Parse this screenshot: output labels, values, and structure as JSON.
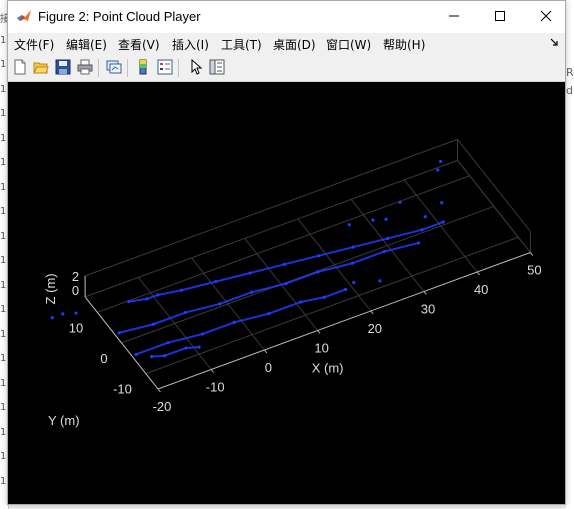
{
  "background": {
    "left_glyphs": [
      "接",
      "1",
      "1",
      "1",
      "1",
      "1",
      "1",
      "1",
      "1",
      "1",
      "1",
      "1",
      "1",
      "1",
      "1",
      "1",
      "1",
      "1",
      "1",
      "1"
    ],
    "right_glyphs": [
      "Re",
      "di"
    ]
  },
  "window": {
    "title": "Figure 2: Point Cloud Player",
    "controls": [
      "minimize",
      "maximize",
      "close"
    ]
  },
  "menu": {
    "items": [
      "文件(F)",
      "编辑(E)",
      "查看(V)",
      "插入(I)",
      "工具(T)",
      "桌面(D)",
      "窗口(W)",
      "帮助(H)"
    ]
  },
  "toolbar": {
    "buttons": [
      {
        "name": "new-figure-icon"
      },
      {
        "name": "open-file-icon"
      },
      {
        "name": "save-icon"
      },
      {
        "name": "print-icon"
      },
      {
        "name": "link-plot-icon"
      },
      {
        "name": "insert-colorbar-icon"
      },
      {
        "name": "insert-legend-icon"
      },
      {
        "name": "edit-plot-arrow-icon"
      },
      {
        "name": "property-inspector-icon"
      }
    ]
  },
  "chart_data": {
    "type": "scatter",
    "projection": "3d",
    "background_color": "#000000",
    "point_color": "#1f3cff",
    "x_label": "X (m)",
    "y_label": "Y (m)",
    "z_label": "Z (m)",
    "x_ticks": [
      -20,
      -10,
      0,
      10,
      20,
      30,
      40,
      50
    ],
    "y_ticks": [
      -10,
      0,
      10
    ],
    "z_ticks": [
      0,
      2
    ],
    "x_range": [
      -20,
      50
    ],
    "y_range": [
      -15,
      15
    ],
    "z_range": [
      -1,
      2
    ],
    "grid": true,
    "series": [
      {
        "points": [
          [
            -15,
            8,
            0
          ],
          [
            -12,
            7,
            0
          ],
          [
            -10,
            7,
            0
          ],
          [
            -6,
            6,
            0
          ],
          [
            0,
            5,
            0
          ],
          [
            6,
            4,
            0
          ],
          [
            12,
            3,
            0
          ],
          [
            18,
            2,
            0
          ],
          [
            24,
            1,
            0
          ],
          [
            30,
            0,
            0
          ],
          [
            36,
            -1,
            0
          ],
          [
            40,
            -1,
            0
          ]
        ]
      },
      {
        "points": [
          [
            -20,
            1,
            0
          ],
          [
            -14,
            0,
            0
          ],
          [
            -8,
            0,
            0
          ],
          [
            -2,
            -1,
            0
          ],
          [
            4,
            -1,
            0
          ],
          [
            10,
            -2,
            0
          ],
          [
            16,
            -2,
            0
          ],
          [
            22,
            -3,
            0
          ],
          [
            28,
            -3,
            0
          ],
          [
            34,
            -4,
            0
          ]
        ]
      },
      {
        "points": [
          [
            -20,
            -6,
            0
          ],
          [
            -14,
            -6,
            0
          ],
          [
            -8,
            -7,
            0
          ],
          [
            -2,
            -7,
            0
          ],
          [
            4,
            -8,
            0
          ],
          [
            10,
            -8,
            0
          ],
          [
            14,
            -9,
            0
          ],
          [
            18,
            -9,
            0
          ],
          [
            -18,
            -8,
            0
          ],
          [
            -16,
            -9,
            0
          ],
          [
            -12,
            -9,
            0
          ],
          [
            -10,
            -10,
            0
          ]
        ]
      },
      {
        "points": [
          [
            -28,
            11,
            0
          ],
          [
            -26,
            11,
            0
          ],
          [
            -24,
            10,
            0
          ],
          [
            44,
            10,
            1.5
          ],
          [
            45,
            11,
            2
          ],
          [
            38,
            2,
            0
          ],
          [
            32,
            5,
            0
          ],
          [
            30,
            6,
            0
          ],
          [
            36,
            8,
            0
          ],
          [
            42,
            4,
            0
          ],
          [
            26,
            7,
            0
          ],
          [
            20,
            -8,
            0
          ],
          [
            24,
            -10,
            0
          ]
        ]
      }
    ]
  }
}
